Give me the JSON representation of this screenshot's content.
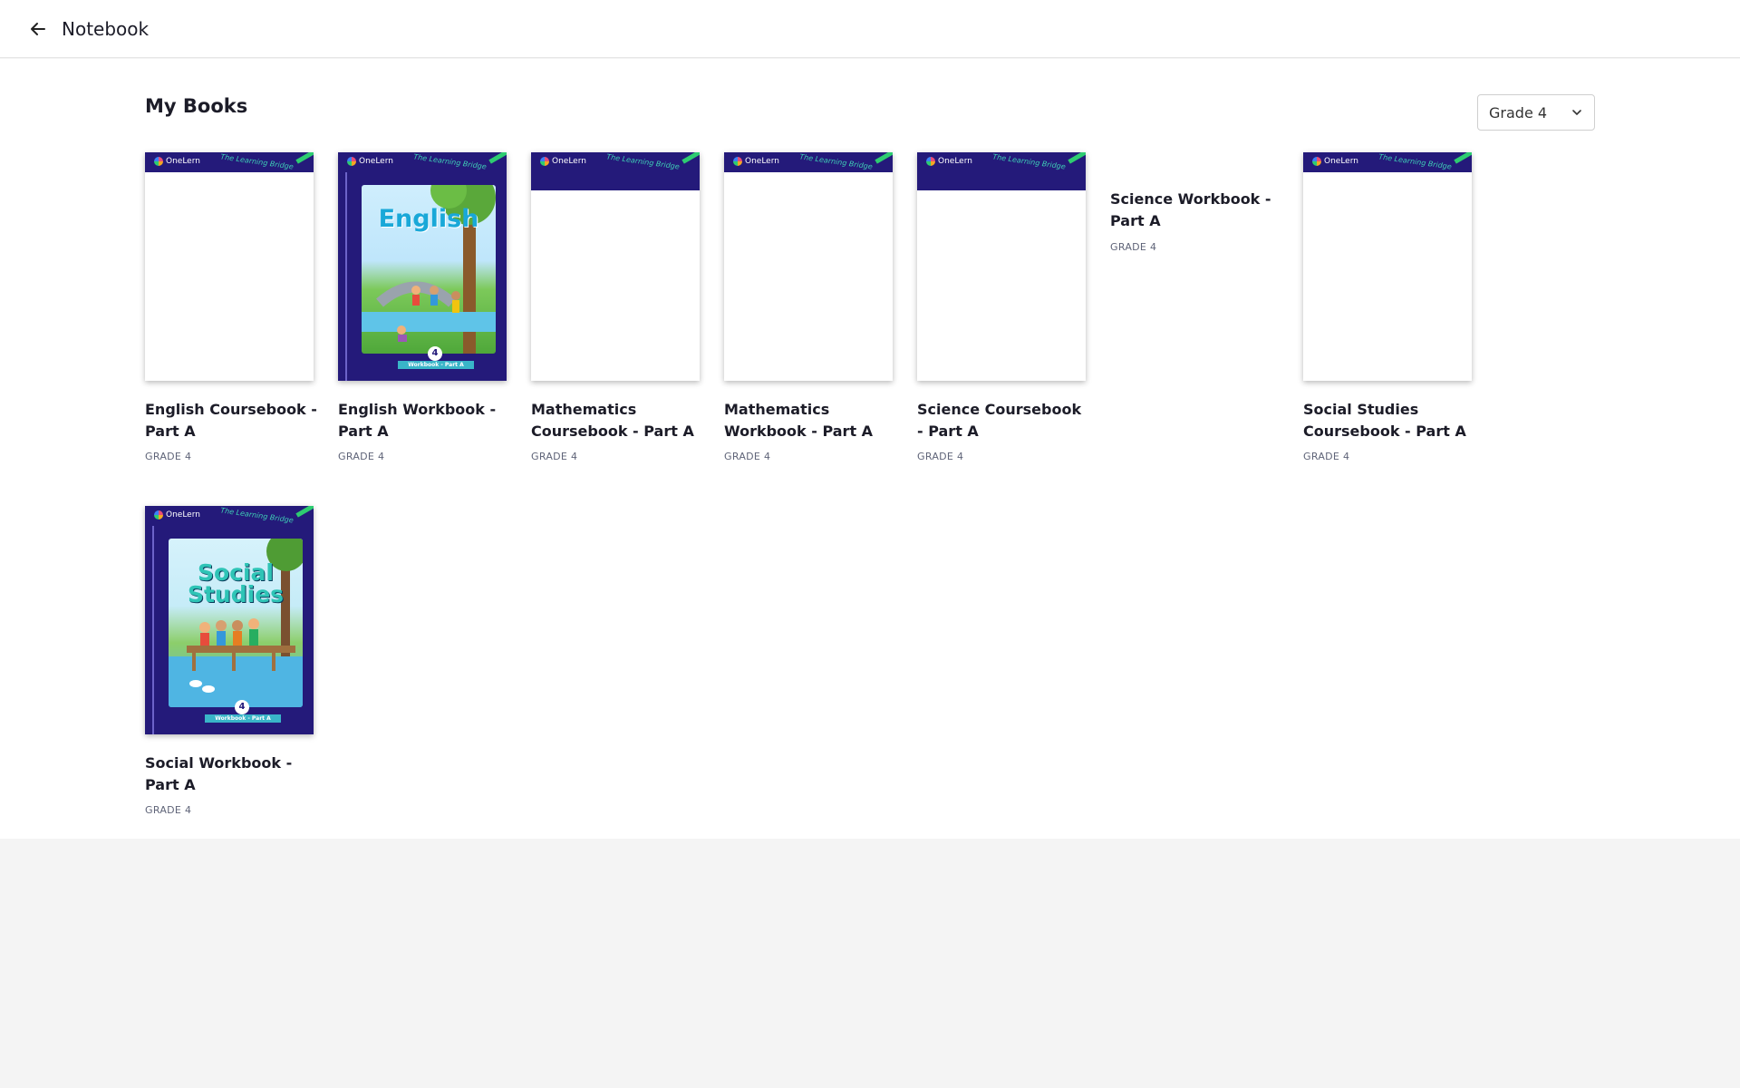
{
  "header": {
    "title": "Notebook"
  },
  "page": {
    "title": "My Books"
  },
  "grade_filter": {
    "selected": "Grade 4"
  },
  "cover_text": {
    "brand": "OneLern",
    "tagline": "The Learning Bridge",
    "grade_number": "4",
    "workbook_ribbon": "Workbook - Part A"
  },
  "books": [
    {
      "title": "English Coursebook - Part A",
      "grade": "GRADE 4",
      "cover": "blank"
    },
    {
      "title": "English Workbook - Part A",
      "grade": "GRADE 4",
      "cover": "english",
      "cover_word": "English"
    },
    {
      "title": "Mathematics Coursebook - Part A",
      "grade": "GRADE 4",
      "cover": "blank"
    },
    {
      "title": "Mathematics Workbook - Part A",
      "grade": "GRADE 4",
      "cover": "blank"
    },
    {
      "title": "Science Coursebook - Part A",
      "grade": "GRADE 4",
      "cover": "blank"
    },
    {
      "title": "Science Workbook - Part A",
      "grade": "GRADE 4",
      "cover": "none"
    },
    {
      "title": "Social Studies Coursebook - Part A",
      "grade": "GRADE 4",
      "cover": "blank"
    },
    {
      "title": "Social Workbook - Part A",
      "grade": "GRADE 4",
      "cover": "social",
      "cover_word_1": "Social",
      "cover_word_2": "Studies"
    }
  ],
  "colors": {
    "cover_navy": "#241a7a",
    "accent_teal": "#3fd0b6",
    "accent_green": "#2ecc71"
  }
}
